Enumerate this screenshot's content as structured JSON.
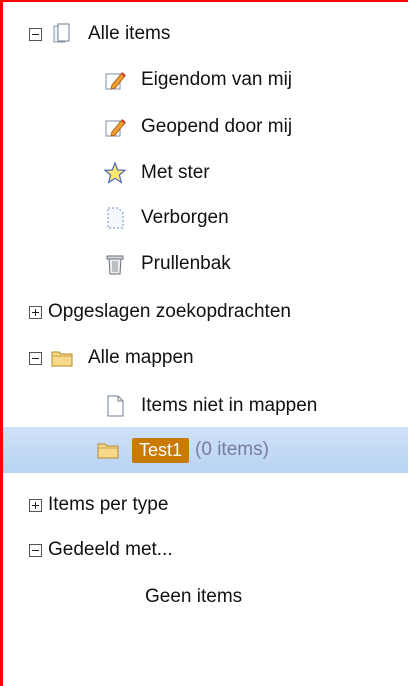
{
  "tree": {
    "all_items": {
      "label": "Alle items",
      "expanded": true,
      "icon": "document-stack-icon"
    },
    "owned": {
      "label": "Eigendom van mij",
      "icon": "pencil-icon"
    },
    "opened": {
      "label": "Geopend door mij",
      "icon": "pencil-icon"
    },
    "starred": {
      "label": "Met ster",
      "icon": "star-icon"
    },
    "hidden": {
      "label": "Verborgen",
      "icon": "dashed-document-icon"
    },
    "trash": {
      "label": "Prullenbak",
      "icon": "trash-icon"
    },
    "saved_searches": {
      "label": "Opgeslagen zoekopdrachten",
      "expanded": false
    },
    "all_folders": {
      "label": "Alle mappen",
      "expanded": true,
      "icon": "folder-icon"
    },
    "not_in_folders": {
      "label": "Items niet in mappen",
      "icon": "document-icon"
    },
    "test1": {
      "label": "Test1",
      "count": "(0 items)",
      "icon": "folder-icon",
      "selected": true
    },
    "by_type": {
      "label": "Items per type",
      "expanded": false
    },
    "shared": {
      "label": "Gedeeld met...",
      "expanded": true
    },
    "no_items": {
      "label": "Geen items"
    }
  },
  "colors": {
    "accent_border": "#ff0000",
    "selection": "#c1daf6",
    "badge": "#c97a00"
  }
}
